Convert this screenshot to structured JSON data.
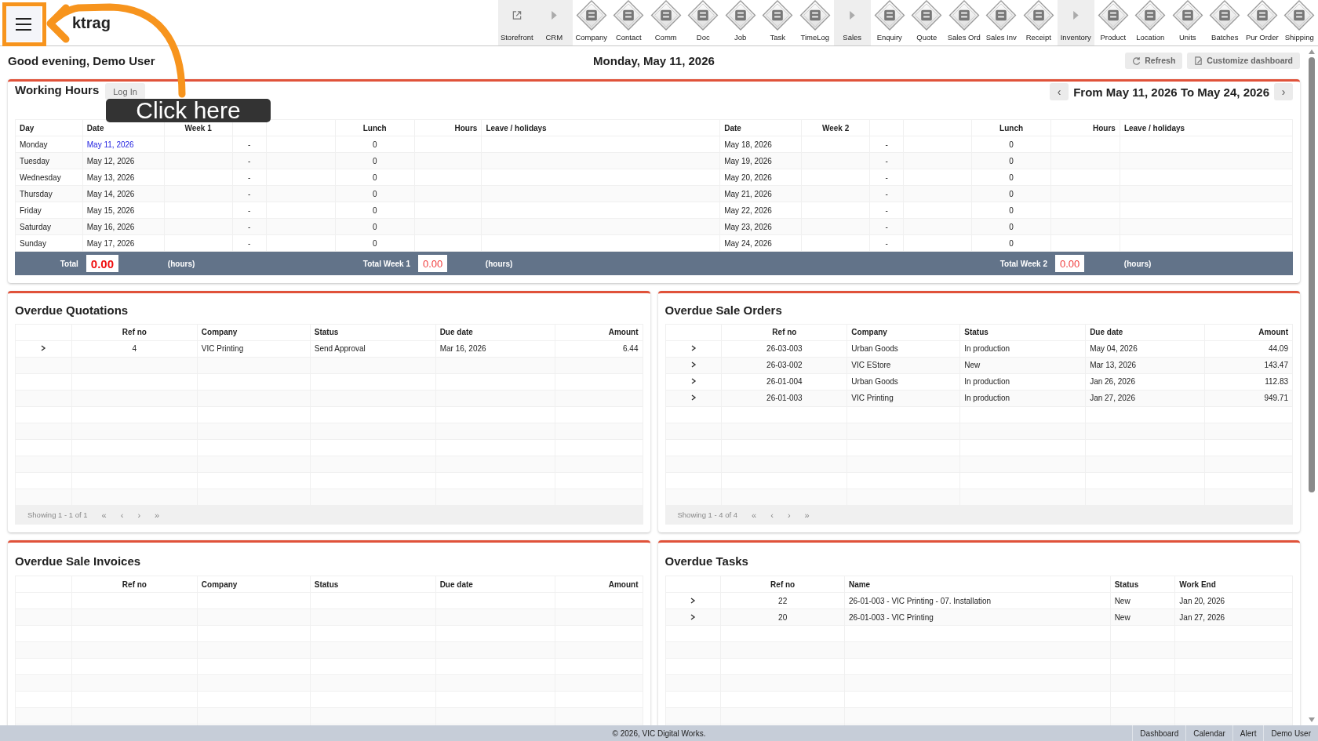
{
  "app": {
    "title": "ktrag"
  },
  "toolbar": [
    {
      "label": "Storefront",
      "kind": "link"
    },
    {
      "label": "CRM",
      "kind": "section"
    },
    {
      "label": "Company",
      "kind": "module"
    },
    {
      "label": "Contact",
      "kind": "module"
    },
    {
      "label": "Comm",
      "kind": "module"
    },
    {
      "label": "Doc",
      "kind": "module"
    },
    {
      "label": "Job",
      "kind": "module"
    },
    {
      "label": "Task",
      "kind": "module"
    },
    {
      "label": "TimeLog",
      "kind": "module"
    },
    {
      "label": "Sales",
      "kind": "section"
    },
    {
      "label": "Enquiry",
      "kind": "module"
    },
    {
      "label": "Quote",
      "kind": "module"
    },
    {
      "label": "Sales Ord",
      "kind": "module"
    },
    {
      "label": "Sales Inv",
      "kind": "module"
    },
    {
      "label": "Receipt",
      "kind": "module"
    },
    {
      "label": "Inventory",
      "kind": "section"
    },
    {
      "label": "Product",
      "kind": "module"
    },
    {
      "label": "Location",
      "kind": "module"
    },
    {
      "label": "Units",
      "kind": "module"
    },
    {
      "label": "Batches",
      "kind": "module"
    },
    {
      "label": "Pur Order",
      "kind": "module"
    },
    {
      "label": "Shipping",
      "kind": "module"
    }
  ],
  "greeting": "Good evening, Demo User",
  "date": "Monday, May 11, 2026",
  "actions": [
    {
      "label": "Refresh",
      "kind": "refresh"
    },
    {
      "label": "Customize dashboard",
      "kind": "customize"
    }
  ],
  "working_hours": {
    "title": "Working Hours",
    "login_button": "Log In",
    "range": "From May 11, 2026 To May 24, 2026",
    "prev": "‹",
    "next": "›",
    "columns": [
      {
        "label": "Day",
        "kind": "day"
      },
      {
        "label": "Date",
        "kind": "date"
      },
      {
        "label": "Week 1",
        "kind": "week"
      },
      {},
      {},
      {
        "label": "Lunch",
        "kind": "lunch"
      },
      {
        "label": "Hours",
        "kind": "hours"
      },
      {
        "label": "Leave / holidays",
        "kind": "leave"
      },
      {
        "label": "Date",
        "kind": "date"
      },
      {
        "label": "Week 2",
        "kind": "week"
      },
      {},
      {},
      {
        "label": "Lunch",
        "kind": "lunch"
      },
      {
        "label": "Hours",
        "kind": "hours"
      },
      {
        "label": "Leave / holidays",
        "kind": "leave"
      }
    ],
    "rows": [
      {
        "day": "Monday",
        "date": "May 11, 2026",
        "today": true,
        "dash": "-",
        "lunch": "0",
        "date_2": "May 18, 2026",
        "dash_2": "-",
        "lunch_2": "0"
      },
      {
        "day": "Tuesday",
        "date": "May 12, 2026",
        "today": false,
        "dash": "-",
        "lunch": "0",
        "date_2": "May 19, 2026",
        "dash_2": "-",
        "lunch_2": "0"
      },
      {
        "day": "Wednesday",
        "date": "May 13, 2026",
        "today": false,
        "dash": "-",
        "lunch": "0",
        "date_2": "May 20, 2026",
        "dash_2": "-",
        "lunch_2": "0"
      },
      {
        "day": "Thursday",
        "date": "May 14, 2026",
        "today": false,
        "dash": "-",
        "lunch": "0",
        "date_2": "May 21, 2026",
        "dash_2": "-",
        "lunch_2": "0"
      },
      {
        "day": "Friday",
        "date": "May 15, 2026",
        "today": false,
        "dash": "-",
        "lunch": "0",
        "date_2": "May 22, 2026",
        "dash_2": "-",
        "lunch_2": "0"
      },
      {
        "day": "Saturday",
        "date": "May 16, 2026",
        "today": false,
        "dash": "-",
        "lunch": "0",
        "date_2": "May 23, 2026",
        "dash_2": "-",
        "lunch_2": "0"
      },
      {
        "day": "Sunday",
        "date": "May 17, 2026",
        "today": false,
        "dash": "-",
        "lunch": "0",
        "date_2": "May 24, 2026",
        "dash_2": "-",
        "lunch_2": "0"
      }
    ],
    "totals": [
      {
        "label": "Total",
        "value": "0.00",
        "unit": "(hours)",
        "emphasis": true
      },
      {
        "label": "Total Week 1",
        "value": "0.00",
        "unit": "(hours)",
        "emphasis": false
      },
      {
        "label": "Total Week 2",
        "value": "0.00",
        "unit": "(hours)",
        "emphasis": false
      }
    ]
  },
  "panels": [
    {
      "title": "Overdue Quotations",
      "columns": [
        {
          "kind": "expander"
        },
        {
          "label": "Ref no",
          "kind": "ref"
        },
        {
          "label": "Company",
          "kind": "company"
        },
        {
          "label": "Status",
          "kind": "status"
        },
        {
          "label": "Due date",
          "kind": "date"
        },
        {
          "label": "Amount",
          "kind": "amount"
        }
      ],
      "rows": [
        [
          "",
          "4",
          "VIC Printing",
          "Send Approval",
          "Mar 16, 2026",
          "6.44"
        ]
      ],
      "pager": {
        "summary": "Showing 1 - 1 of 1",
        "buttons": [
          "«",
          "‹",
          "›",
          "»"
        ]
      }
    },
    {
      "title": "Overdue Sale Orders",
      "columns": [
        {
          "kind": "expander"
        },
        {
          "label": "Ref no",
          "kind": "ref"
        },
        {
          "label": "Company",
          "kind": "company"
        },
        {
          "label": "Status",
          "kind": "status"
        },
        {
          "label": "Due date",
          "kind": "date"
        },
        {
          "label": "Amount",
          "kind": "amount"
        }
      ],
      "rows": [
        [
          "",
          "26-03-003",
          "Urban Goods",
          "In production",
          "May 04, 2026",
          "44.09"
        ],
        [
          "",
          "26-03-002",
          "VIC EStore",
          "New",
          "Mar 13, 2026",
          "143.47"
        ],
        [
          "",
          "26-01-004",
          "Urban Goods",
          "In production",
          "Jan 26, 2026",
          "112.83"
        ],
        [
          "",
          "26-01-003",
          "VIC Printing",
          "In production",
          "Jan 27, 2026",
          "949.71"
        ]
      ],
      "pager": {
        "summary": "Showing 1 - 4 of 4",
        "buttons": [
          "«",
          "‹",
          "›",
          "»"
        ]
      }
    },
    {
      "title": "Overdue Sale Invoices",
      "columns": [
        {
          "kind": "expander"
        },
        {
          "label": "Ref no",
          "kind": "ref"
        },
        {
          "label": "Company",
          "kind": "company"
        },
        {
          "label": "Status",
          "kind": "status"
        },
        {
          "label": "Due date",
          "kind": "date"
        },
        {
          "label": "Amount",
          "kind": "amount"
        }
      ]
    },
    {
      "title": "Overdue Tasks",
      "columns": [
        {
          "kind": "expander"
        },
        {
          "label": "Ref no",
          "kind": "ref"
        },
        {
          "label": "Name",
          "kind": "name"
        },
        {
          "label": "Status",
          "kind": "short"
        },
        {
          "label": "Work End",
          "kind": "date"
        }
      ],
      "rows": [
        [
          "",
          "22",
          "26-01-003 - VIC Printing - 07. Installation",
          "New",
          "Jan 20, 2026"
        ],
        [
          "",
          "20",
          "26-01-003 - VIC Printing",
          "New",
          "Jan 27, 2026"
        ]
      ]
    }
  ],
  "footer": {
    "copyright": "© 2026, VIC Digital Works.",
    "links": [
      "Dashboard",
      "Calendar",
      "Alert",
      "Demo User"
    ]
  },
  "annotation": {
    "text": "Click here"
  }
}
